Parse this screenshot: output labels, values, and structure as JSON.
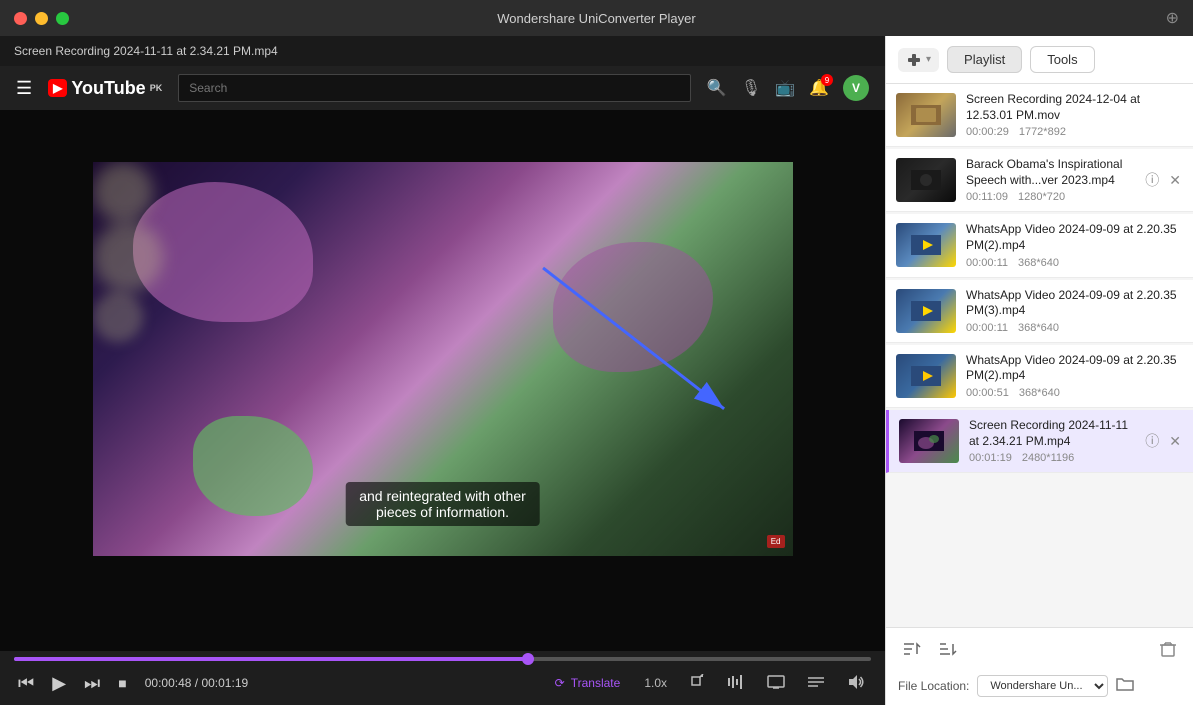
{
  "window": {
    "title": "Wondershare UniConverter Player"
  },
  "titlebar": {
    "close": "●",
    "minimize": "●",
    "maximize": "●",
    "pin_icon": "⊕"
  },
  "video": {
    "title": "Screen Recording 2024-11-11 at 2.34.21 PM.mp4",
    "subtitle_line1": "and reintegrated with other",
    "subtitle_line2": "pieces of information.",
    "corner_badge": "Ed",
    "current_time": "00:00:48",
    "total_time": "00:01:19",
    "progress_percent": 60
  },
  "youtube_bar": {
    "logo_text": "YouTube",
    "logo_suffix": "PK",
    "search_placeholder": "Search",
    "avatar_initial": "V"
  },
  "controls": {
    "prev_label": "⏮",
    "play_label": "▶",
    "next_label": "⏭",
    "stop_label": "■",
    "translate_label": "Translate",
    "speed_label": "1.0x",
    "crop_label": "↗",
    "audio_label": "▐▐▐",
    "display_label": "⊡",
    "subtitle_label": "≡",
    "volume_label": "🔊"
  },
  "panel": {
    "add_label": "+",
    "tabs": [
      {
        "id": "playlist",
        "label": "Playlist",
        "active": true
      },
      {
        "id": "tools",
        "label": "Tools",
        "active": false
      }
    ]
  },
  "playlist": {
    "items": [
      {
        "id": 1,
        "name": "Screen Recording 2024-12-04 at 12.53.01 PM.mov",
        "duration": "00:00:29",
        "resolution": "1772*892",
        "thumb_class": "thumb-img-1",
        "active": false,
        "show_actions": false
      },
      {
        "id": 2,
        "name": "Barack Obama's Inspirational Speech with...ver 2023.mp4",
        "duration": "00:11:09",
        "resolution": "1280*720",
        "thumb_class": "thumb-img-2",
        "active": false,
        "show_actions": true
      },
      {
        "id": 3,
        "name": "WhatsApp Video 2024-09-09 at 2.20.35 PM(2).mp4",
        "duration": "00:00:11",
        "resolution": "368*640",
        "thumb_class": "thumb-img-3",
        "active": false,
        "show_actions": false
      },
      {
        "id": 4,
        "name": "WhatsApp Video 2024-09-09 at 2.20.35 PM(3).mp4",
        "duration": "00:00:11",
        "resolution": "368*640",
        "thumb_class": "thumb-img-4",
        "active": false,
        "show_actions": false
      },
      {
        "id": 5,
        "name": "WhatsApp Video 2024-09-09 at 2.20.35 PM(2).mp4",
        "duration": "00:00:51",
        "resolution": "368*640",
        "thumb_class": "thumb-img-5",
        "active": false,
        "show_actions": false
      },
      {
        "id": 6,
        "name": "Screen Recording 2024-11-11 at 2.34.21 PM.mp4",
        "duration": "00:01:19",
        "resolution": "2480*1196",
        "thumb_class": "thumb-img-6",
        "active": true,
        "show_actions": true
      }
    ]
  },
  "footer": {
    "sort_asc_icon": "↑≡",
    "sort_desc_icon": "↓≡",
    "delete_icon": "🗑",
    "location_label": "File Location:",
    "location_value": "Wondershare Un...",
    "folder_icon": "📁"
  }
}
